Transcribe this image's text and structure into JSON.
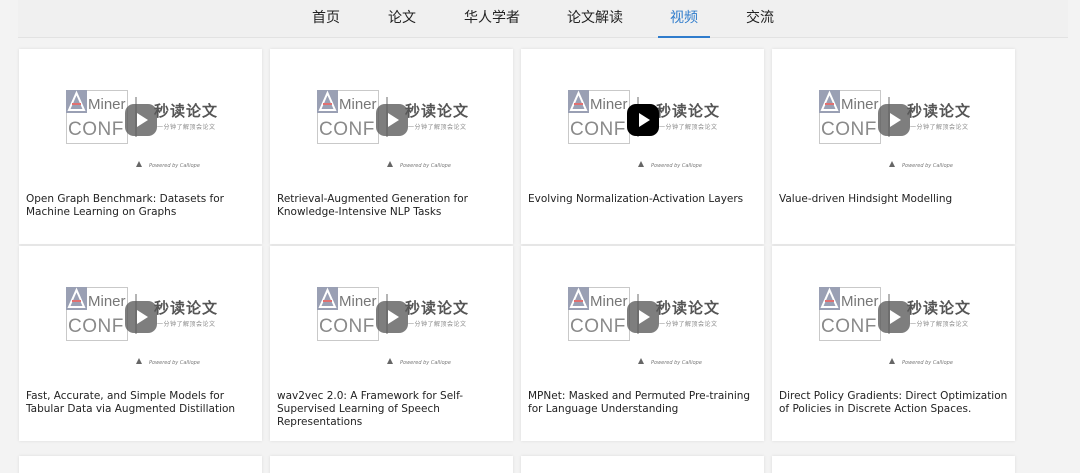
{
  "nav": {
    "tabs": [
      {
        "label": "首页",
        "active": false
      },
      {
        "label": "论文",
        "active": false
      },
      {
        "label": "华人学者",
        "active": false
      },
      {
        "label": "论文解读",
        "active": false
      },
      {
        "label": "视频",
        "active": true
      },
      {
        "label": "交流",
        "active": false
      }
    ],
    "active_color": "#2f7ccc"
  },
  "thumbnail": {
    "logo_miner": "Miner",
    "logo_conf": "CONF",
    "logo_title": "秒读论文",
    "logo_subtitle": "一分钟了解顶会论文",
    "powered_by": "Powered by Calliope"
  },
  "videos": [
    {
      "title": "Open Graph Benchmark: Datasets for Machine Learning on Graphs",
      "play_icon": "play-icon",
      "hovered": false
    },
    {
      "title": "Retrieval-Augmented Generation for Knowledge-Intensive NLP Tasks",
      "play_icon": "play-icon",
      "hovered": false
    },
    {
      "title": "Evolving Normalization-Activation Layers",
      "play_icon": "play-icon",
      "hovered": true
    },
    {
      "title": "Value-driven Hindsight Modelling",
      "play_icon": "play-icon",
      "hovered": false
    },
    {
      "title": "Fast, Accurate, and Simple Models for Tabular Data via Augmented Distillation",
      "play_icon": "play-icon",
      "hovered": false
    },
    {
      "title": "wav2vec 2.0: A Framework for Self-Supervised Learning of Speech Representations",
      "play_icon": "play-icon",
      "hovered": false
    },
    {
      "title": "MPNet: Masked and Permuted Pre-training for Language Understanding",
      "play_icon": "play-icon",
      "hovered": false
    },
    {
      "title": "Direct Policy Gradients: Direct Optimization of Policies in Discrete Action Spaces.",
      "play_icon": "play-icon",
      "hovered": false
    }
  ]
}
